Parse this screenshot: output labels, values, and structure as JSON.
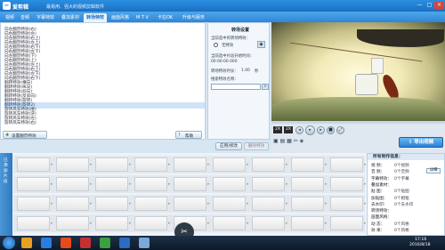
{
  "app": {
    "name": "爱剪辑",
    "subtitle": "最易用、强大的视频剪辑软件"
  },
  "window_controls": [
    "—",
    "□",
    "×"
  ],
  "menu": {
    "tabs": [
      "视频",
      "音频",
      "字幕特效",
      "叠加素材",
      "转场特效",
      "画面风格",
      "M T V",
      "卡拉OK",
      "升级与服务"
    ],
    "active_index": 4
  },
  "transitions": {
    "items": [
      "向左翻页特效(右)",
      "向右翻页特效(左)",
      "向左翻页特效(右上)",
      "向右翻页特效(左上)",
      "向左翻页特效(右下)",
      "向右翻页特效(左下)",
      "向左翻页特效(下)",
      "向右翻页特效(上)",
      "向左翻页特效(左上)",
      "向右翻页特效(右上)",
      "向左翻页特效(左下)",
      "向右翻页特效(右下)",
      "翻转特效(横向)",
      "翻转特效(纵向)",
      "翻转特效(斜向)",
      "翻转特效(反斜向)",
      "翻转特效(旋转)",
      "翻转特效(旋转2)",
      "旋转风车特效(顺)",
      "旋转风车特效(逆)",
      "旋转风车特效(左)",
      "旋转风车特效(右)"
    ],
    "selected_index": 17,
    "add_button": "设置翻页特效",
    "help_button": "帮助"
  },
  "settings": {
    "title": "转场设置",
    "selected_label": "当前选中的转场特效：",
    "selected_value": "无特效",
    "start_label": "当前选中片段开始时间：",
    "start_value": "00:00:00.000",
    "duration_label": "转场特效时长：",
    "duration_value": "1.00",
    "duration_unit": "秒",
    "search_label": "搜索特效名称：",
    "apply_button": "应用/修改",
    "delete_button": "删除特效"
  },
  "player": {
    "zoom": "2X",
    "speed": "2X",
    "export_button": "导出视频"
  },
  "timeline": {
    "side_label": "已添加片段",
    "rows": 4
  },
  "info": {
    "title": "所有制作信息：",
    "rows": [
      {
        "label": "视  频：",
        "value": "0个视频"
      },
      {
        "label": "音  频：",
        "value": "0个音频",
        "action": "详细"
      },
      {
        "label": "字幕特效：",
        "value": "0个字幕"
      },
      {
        "label": "叠加素材：",
        "value": ""
      },
      {
        "label": "贴  图：",
        "value": "0个贴图"
      },
      {
        "label": "加贴图：",
        "value": "0个相框"
      },
      {
        "label": "去水印：",
        "value": "0个去水印"
      },
      {
        "label": "转场特效：",
        "value": ""
      },
      {
        "label": "画面风格：",
        "value": ""
      },
      {
        "label": "动  态：",
        "value": "0个风格"
      },
      {
        "label": "效  果：",
        "value": "0个风格"
      }
    ]
  },
  "taskbar": {
    "time": "17:16",
    "date": "2016/8/18",
    "icon_colors": [
      "#e8a020",
      "#2a7de0",
      "#e84a1a",
      "#c83030",
      "#3aa040",
      "#2c6cc0",
      "#7aa8d8"
    ]
  }
}
